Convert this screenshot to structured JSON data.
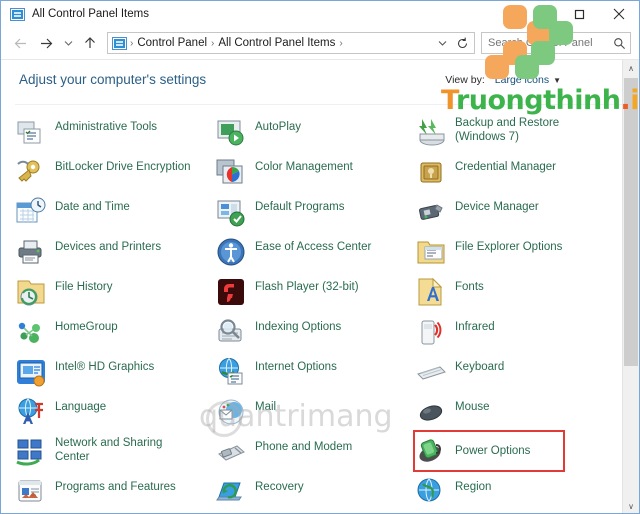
{
  "window": {
    "title": "All Control Panel Items",
    "title_icon": "control-panel-icon",
    "minimize_label": "Minimize",
    "maximize_label": "Maximize",
    "close_label": "Close"
  },
  "nav": {
    "back_label": "Back",
    "forward_label": "Forward",
    "recent_label": "Recent locations",
    "up_label": "Up",
    "breadcrumbs": [
      "Control Panel",
      "All Control Panel Items"
    ],
    "separator": "›",
    "dropdown_label": "Previous locations",
    "refresh_label": "Refresh"
  },
  "search": {
    "placeholder": "Search Control Panel",
    "value": "",
    "icon": "search-icon"
  },
  "content": {
    "heading": "Adjust your computer's settings",
    "view_by_label": "View by:",
    "view_by_value": "Large icons",
    "view_by_caret": "▼"
  },
  "items": [
    {
      "label": "Administrative Tools",
      "icon": "administrative-tools-icon",
      "col": 1
    },
    {
      "label": "AutoPlay",
      "icon": "autoplay-icon",
      "col": 2
    },
    {
      "label": "Backup and Restore\n(Windows 7)",
      "icon": "backup-and-restore-icon",
      "col": 3,
      "two_line": true
    },
    {
      "label": "BitLocker Drive Encryption",
      "icon": "bitlocker-icon",
      "col": 1
    },
    {
      "label": "Color Management",
      "icon": "color-management-icon",
      "col": 2
    },
    {
      "label": "Credential Manager",
      "icon": "credential-manager-icon",
      "col": 3
    },
    {
      "label": "Date and Time",
      "icon": "date-and-time-icon",
      "col": 1
    },
    {
      "label": "Default Programs",
      "icon": "default-programs-icon",
      "col": 2
    },
    {
      "label": "Device Manager",
      "icon": "device-manager-icon",
      "col": 3
    },
    {
      "label": "Devices and Printers",
      "icon": "devices-and-printers-icon",
      "col": 1
    },
    {
      "label": "Ease of Access Center",
      "icon": "ease-of-access-icon",
      "col": 2
    },
    {
      "label": "File Explorer Options",
      "icon": "file-explorer-options-icon",
      "col": 3
    },
    {
      "label": "File History",
      "icon": "file-history-icon",
      "col": 1
    },
    {
      "label": "Flash Player (32-bit)",
      "icon": "flash-player-icon",
      "col": 2
    },
    {
      "label": "Fonts",
      "icon": "fonts-icon",
      "col": 3
    },
    {
      "label": "HomeGroup",
      "icon": "homegroup-icon",
      "col": 1
    },
    {
      "label": "Indexing Options",
      "icon": "indexing-options-icon",
      "col": 2
    },
    {
      "label": "Infrared",
      "icon": "infrared-icon",
      "col": 3
    },
    {
      "label": "Intel® HD Graphics",
      "icon": "intel-hd-graphics-icon",
      "col": 1
    },
    {
      "label": "Internet Options",
      "icon": "internet-options-icon",
      "col": 2
    },
    {
      "label": "Keyboard",
      "icon": "keyboard-icon",
      "col": 3
    },
    {
      "label": "Language",
      "icon": "language-icon",
      "col": 1
    },
    {
      "label": "Mail",
      "icon": "mail-icon",
      "col": 2
    },
    {
      "label": "Mouse",
      "icon": "mouse-icon",
      "col": 3
    },
    {
      "label": "Network and Sharing\nCenter",
      "icon": "network-and-sharing-icon",
      "col": 1,
      "two_line": true
    },
    {
      "label": "Phone and Modem",
      "icon": "phone-and-modem-icon",
      "col": 2
    },
    {
      "label": "Power Options",
      "icon": "power-options-icon",
      "col": 3,
      "highlighted": true
    },
    {
      "label": "Programs and Features",
      "icon": "programs-and-features-icon",
      "col": 1
    },
    {
      "label": "Recovery",
      "icon": "recovery-icon",
      "col": 2
    },
    {
      "label": "Region",
      "icon": "region-icon",
      "col": 3
    }
  ],
  "scrollbar": {
    "up_arrow": "∧",
    "down_arrow": "∨"
  },
  "watermarks": {
    "brand_t": "T",
    "brand_mid": "ruongthinh",
    "brand_dot": ".",
    "brand_info": "info",
    "center_text": "quantrimang",
    "logo_colors": {
      "orange": "#f5a85c",
      "green": "#7dc97f"
    },
    "highlight_color": "#e03b36"
  }
}
